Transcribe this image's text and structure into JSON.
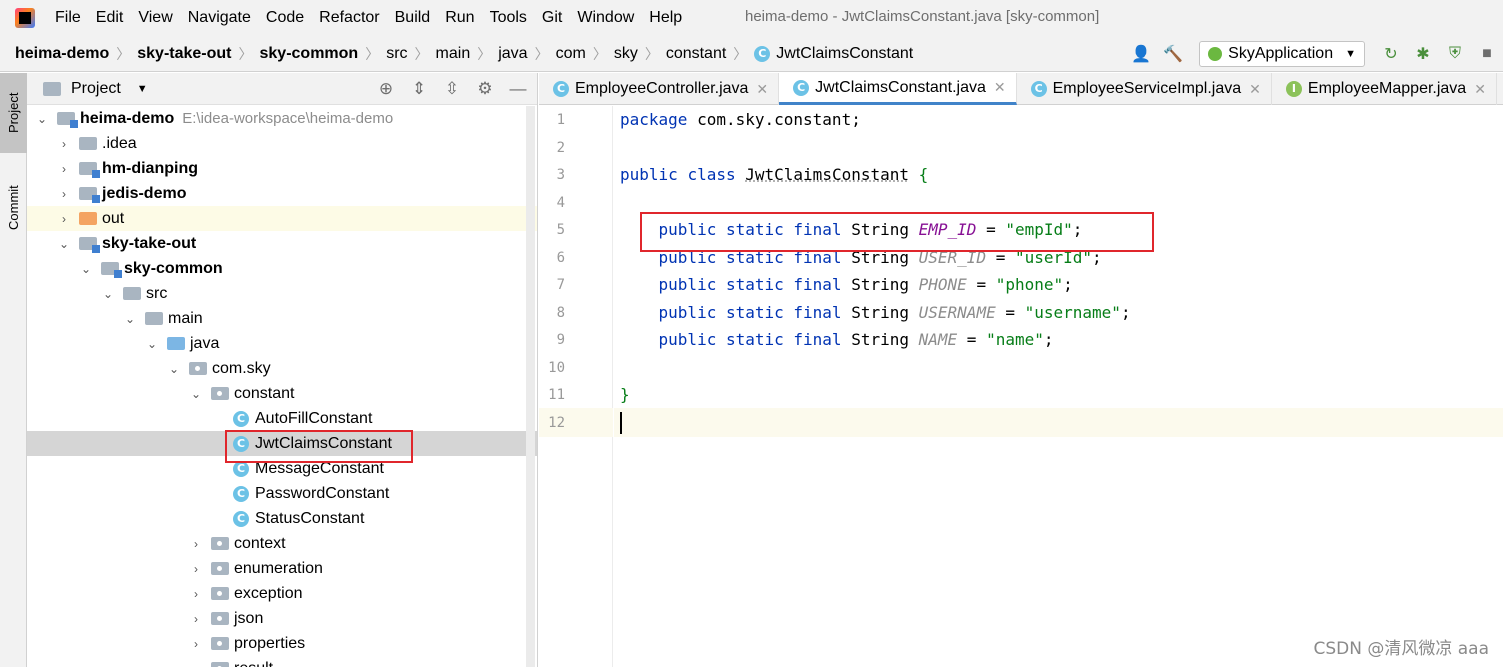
{
  "menu": [
    "File",
    "Edit",
    "View",
    "Navigate",
    "Code",
    "Refactor",
    "Build",
    "Run",
    "Tools",
    "Git",
    "Window",
    "Help"
  ],
  "window_title": "heima-demo - JwtClaimsConstant.java [sky-common]",
  "breadcrumbs": [
    "heima-demo",
    "sky-take-out",
    "sky-common",
    "src",
    "main",
    "java",
    "com",
    "sky",
    "constant",
    "JwtClaimsConstant"
  ],
  "run_config": "SkyApplication",
  "side_tabs": {
    "project": "Project",
    "commit": "Commit"
  },
  "project_panel": {
    "title": "Project"
  },
  "tree": [
    {
      "name": "heima-demo",
      "path": "E:\\idea-workspace\\heima-demo"
    },
    {
      "name": ".idea"
    },
    {
      "name": "hm-dianping"
    },
    {
      "name": "jedis-demo"
    },
    {
      "name": "out"
    },
    {
      "name": "sky-take-out"
    },
    {
      "name": "sky-common"
    },
    {
      "name": "src"
    },
    {
      "name": "main"
    },
    {
      "name": "java"
    },
    {
      "name": "com.sky"
    },
    {
      "name": "constant"
    },
    {
      "name": "AutoFillConstant"
    },
    {
      "name": "JwtClaimsConstant"
    },
    {
      "name": "MessageConstant"
    },
    {
      "name": "PasswordConstant"
    },
    {
      "name": "StatusConstant"
    },
    {
      "name": "context"
    },
    {
      "name": "enumeration"
    },
    {
      "name": "exception"
    },
    {
      "name": "json"
    },
    {
      "name": "properties"
    },
    {
      "name": "result"
    }
  ],
  "tabs": [
    {
      "label": "EmployeeController.java",
      "icon": "C"
    },
    {
      "label": "JwtClaimsConstant.java",
      "icon": "C"
    },
    {
      "label": "EmployeeServiceImpl.java",
      "icon": "C"
    },
    {
      "label": "EmployeeMapper.java",
      "icon": "I"
    }
  ],
  "line_numbers": [
    "1",
    "2",
    "3",
    "4",
    "5",
    "6",
    "7",
    "8",
    "9",
    "10",
    "11",
    "12"
  ],
  "code": {
    "l1_kw": "package",
    "l1_rest": " com.sky.constant;",
    "l3_kw1": "public",
    "l3_kw2": "class",
    "l3_name": "JwtClaimsConstant",
    "l3_brace": "{",
    "mod": "public static final",
    "type": "String",
    "fields": [
      {
        "name": "EMP_ID",
        "value": "\"empId\""
      },
      {
        "name": "USER_ID",
        "value": "\"userId\""
      },
      {
        "name": "PHONE",
        "value": "\"phone\""
      },
      {
        "name": "USERNAME",
        "value": "\"username\""
      },
      {
        "name": "NAME",
        "value": "\"name\""
      }
    ],
    "eq": " = ",
    "semi": ";",
    "close": "}"
  },
  "watermark": "CSDN @清风微凉 aaa"
}
